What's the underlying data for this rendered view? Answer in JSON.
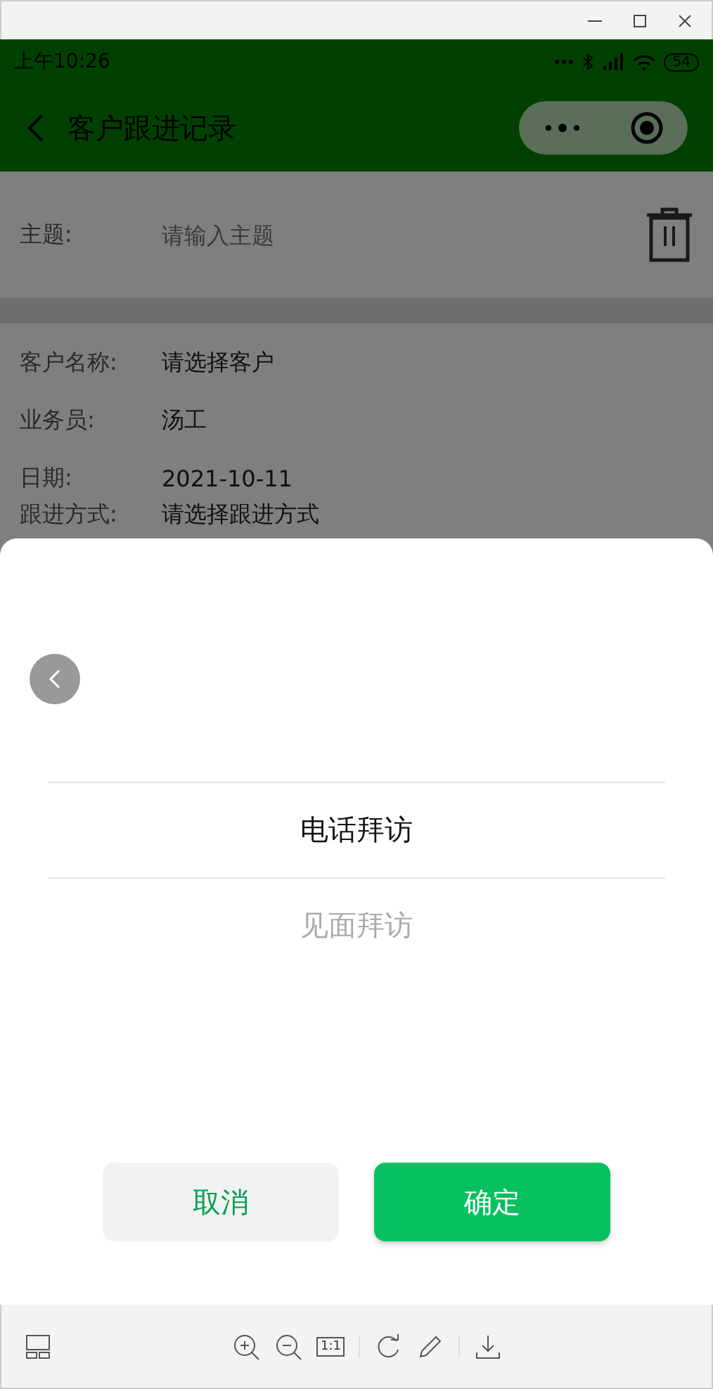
{
  "status_bar": {
    "time": "上午10:26",
    "battery": "54"
  },
  "nav": {
    "title": "客户跟进记录"
  },
  "subject": {
    "label": "主题:",
    "placeholder": "请输入主题"
  },
  "fields": [
    {
      "label": "客户名称:",
      "value": "请选择客户"
    },
    {
      "label": "业务员:",
      "value": "汤工"
    },
    {
      "label": "日期:",
      "value": "2021-10-11"
    },
    {
      "label": "跟进方式:",
      "value": "请选择跟进方式"
    }
  ],
  "picker": {
    "options": [
      {
        "label": "电话拜访",
        "selected": true
      },
      {
        "label": "见面拜访",
        "selected": false
      }
    ],
    "buttons": [
      {
        "label": "取消",
        "kind": "cancel"
      },
      {
        "label": "确定",
        "kind": "confirm"
      }
    ]
  },
  "viewer_toolbar": {
    "actual_size": "1:1"
  }
}
